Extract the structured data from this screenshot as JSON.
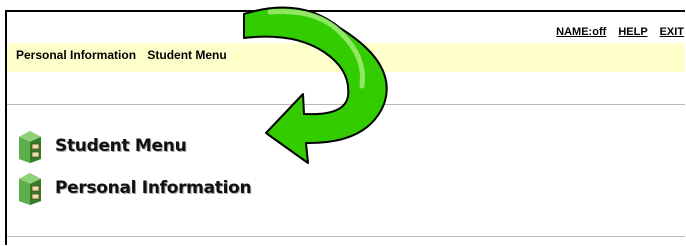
{
  "header": {
    "links": {
      "name": "NAME:off",
      "help": "HELP",
      "exit": "EXIT"
    }
  },
  "breadcrumb": {
    "items": [
      "Personal Information",
      "Student Menu"
    ]
  },
  "menu": {
    "items": [
      {
        "label": "Student Menu",
        "icon": "cabinet-icon"
      },
      {
        "label": "Personal Information",
        "icon": "cabinet-icon"
      }
    ]
  },
  "colors": {
    "breadcrumb_bar": "#ffffcc",
    "icon_green": "#3e8e33",
    "arrow_green": "#33cc00"
  },
  "annotation": {
    "icon": "curved-arrow-icon"
  }
}
